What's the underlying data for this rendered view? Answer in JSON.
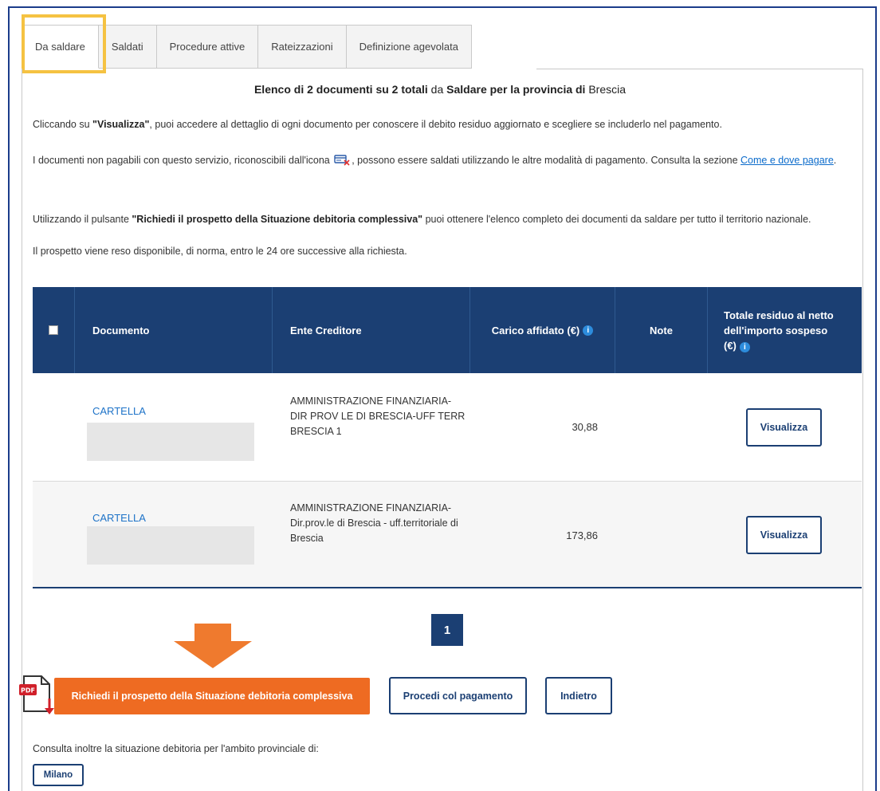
{
  "tabs": [
    {
      "label": "Da saldare",
      "active": true
    },
    {
      "label": "Saldati",
      "active": false
    },
    {
      "label": "Procedure attive",
      "active": false
    },
    {
      "label": "Rateizzazioni",
      "active": false
    },
    {
      "label": "Definizione agevolata",
      "active": false
    }
  ],
  "heading": {
    "prefix": "Elenco di 2 documenti su 2 totali",
    "middle": " da ",
    "saldare": "Saldare per la provincia di",
    "province": " Brescia"
  },
  "intro": {
    "p1_a": "Cliccando su ",
    "p1_bold": "\"Visualizza\"",
    "p1_b": ", puoi accedere al dettaglio di ogni documento per conoscere il debito residuo aggiornato e scegliere se includerlo nel pagamento.",
    "p2_a": "I documenti non pagabili con questo servizio, riconoscibili dall'icona",
    "p2_b": ", possono essere saldati utilizzando le altre modalità di pagamento. Consulta la sezione ",
    "p2_link": "Come e dove pagare",
    "p2_c": ".",
    "p3_a": "Utilizzando il pulsante ",
    "p3_bold": "\"Richiedi il prospetto della Situazione debitoria complessiva\"",
    "p3_b": " puoi ottenere l'elenco completo dei documenti da saldare per tutto il territorio nazionale.",
    "p4": "Il prospetto viene reso disponibile, di norma, entro le 24 ore successive alla richiesta."
  },
  "table": {
    "headers": {
      "documento": "Documento",
      "ente": "Ente Creditore",
      "carico": "Carico affidato (€)",
      "note": "Note",
      "totale": "Totale residuo al netto dell'importo sospeso (€)"
    },
    "rows": [
      {
        "documento": "CARTELLA",
        "ente": "AMMINISTRAZIONE FINANZIARIA- DIR PROV LE DI BRESCIA-UFF TERR BRESCIA 1",
        "carico": "30,88",
        "note": "",
        "action": "Visualizza"
      },
      {
        "documento": "CARTELLA",
        "ente": "AMMINISTRAZIONE FINANZIARIA- Dir.prov.le di Brescia - uff.territoriale di Brescia",
        "carico": "173,86",
        "note": "",
        "action": "Visualizza"
      }
    ]
  },
  "pagination": {
    "current": "1"
  },
  "buttons": {
    "richiedi": "Richiedi il prospetto della Situazione debitoria complessiva",
    "procedi": "Procedi col pagamento",
    "indietro": "Indietro",
    "milano": "Milano"
  },
  "pdf_label": "PDF",
  "consult_text": "Consulta inoltre la situazione debitoria per l'ambito provinciale di:",
  "colors": {
    "header_bg": "#1b3f73",
    "accent_orange": "#ee6b22",
    "highlight_yellow": "#f5c242",
    "link_blue": "#1e73c8"
  }
}
